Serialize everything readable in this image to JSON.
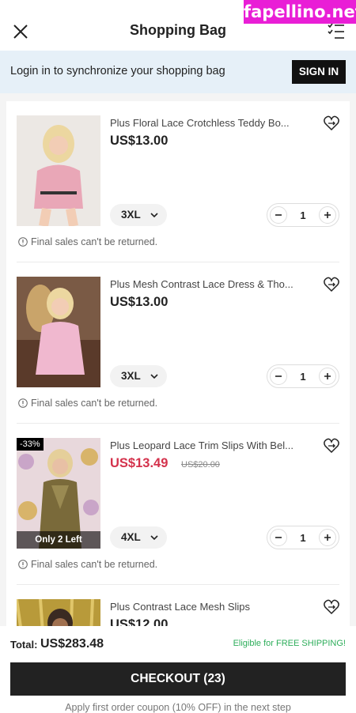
{
  "watermark": "fapellino.net",
  "header": {
    "title": "Shopping Bag",
    "close_icon": "close-icon",
    "manage_icon": "checklist-icon"
  },
  "login_banner": {
    "text": "Login in to synchronize your shopping bag",
    "button_label": "SIGN IN",
    "background": "#e6f0f8"
  },
  "items": [
    {
      "title": "Plus Floral Lace Crotchless Teddy Bo...",
      "price": "US$13.00",
      "size": "3XL",
      "quantity": "1",
      "note": "Final sales can't be returned."
    },
    {
      "title": "Plus Mesh Contrast Lace Dress & Tho...",
      "price": "US$13.00",
      "size": "3XL",
      "quantity": "1",
      "note": "Final sales can't be returned."
    },
    {
      "title": "Plus Leopard Lace Trim Slips With Bel...",
      "price": "US$13.49",
      "original_price": "US$20.00",
      "discount": "-33%",
      "stock_label": "Only 2 Left",
      "size": "4XL",
      "quantity": "1",
      "note": "Final sales can't be returned."
    },
    {
      "title": "Plus Contrast Lace Mesh Slips",
      "price": "US$12.00"
    }
  ],
  "footer": {
    "total_label": "Total:",
    "total_value": "US$283.48",
    "shipping_note": "Eligible for FREE SHIPPING!",
    "checkout_label": "CHECKOUT (23)",
    "coupon_note": "Apply first order coupon (10% OFF) in the next step"
  },
  "colors": {
    "accent": "#222222",
    "sale": "#d4324c",
    "free_shipping": "#2eae5b",
    "watermark": "#e91ed6"
  }
}
